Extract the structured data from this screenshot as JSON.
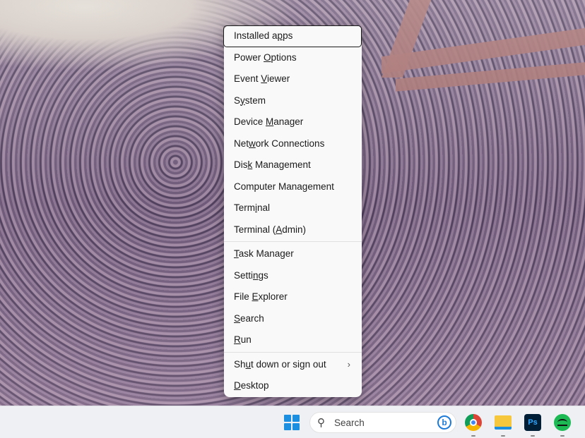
{
  "menu": {
    "items": [
      {
        "pre": "Installed a",
        "key": "p",
        "post": "ps"
      },
      {
        "pre": "Power ",
        "key": "O",
        "post": "ptions"
      },
      {
        "pre": "Event ",
        "key": "V",
        "post": "iewer"
      },
      {
        "pre": "S",
        "key": "y",
        "post": "stem"
      },
      {
        "pre": "Device ",
        "key": "M",
        "post": "anager"
      },
      {
        "pre": "Net",
        "key": "w",
        "post": "ork Connections"
      },
      {
        "pre": "Dis",
        "key": "k",
        "post": " Management"
      },
      {
        "pre": "Computer Mana",
        "key": "g",
        "post": "ement"
      },
      {
        "pre": "Term",
        "key": "i",
        "post": "nal"
      },
      {
        "pre": "Terminal (",
        "key": "A",
        "post": "dmin)"
      },
      {
        "pre": "",
        "key": "T",
        "post": "ask Manager"
      },
      {
        "pre": "Setti",
        "key": "n",
        "post": "gs"
      },
      {
        "pre": "File ",
        "key": "E",
        "post": "xplorer"
      },
      {
        "pre": "",
        "key": "S",
        "post": "earch"
      },
      {
        "pre": "",
        "key": "R",
        "post": "un"
      },
      {
        "pre": "Sh",
        "key": "u",
        "post": "t down or sign out"
      },
      {
        "pre": "",
        "key": "D",
        "post": "esktop"
      }
    ],
    "submenu_chevron": "›"
  },
  "taskbar": {
    "search_placeholder": "Search",
    "bing_label": "b",
    "ps_label": "Ps"
  }
}
